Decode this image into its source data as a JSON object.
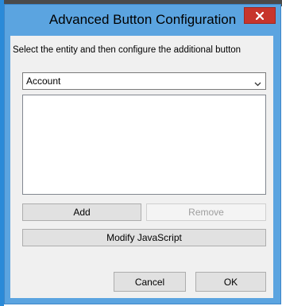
{
  "window": {
    "title": "Advanced Button Configuration",
    "close_label": "x"
  },
  "content": {
    "instruction": "Select the entity and then configure the additional button"
  },
  "entity_select": {
    "value": "Account"
  },
  "buttons_list": {
    "items": []
  },
  "actions": {
    "add_label": "Add",
    "remove_label": "Remove",
    "remove_enabled": false,
    "modify_label": "Modify JavaScript",
    "cancel_label": "Cancel",
    "ok_label": "OK"
  },
  "colors": {
    "title_bar": "#5ba4e0",
    "close_button": "#c7352c",
    "client_background": "#f0f0f0",
    "button_face": "#e1e1e1"
  },
  "icons": {
    "close": "close-icon",
    "dropdown": "chevron-down-icon"
  }
}
